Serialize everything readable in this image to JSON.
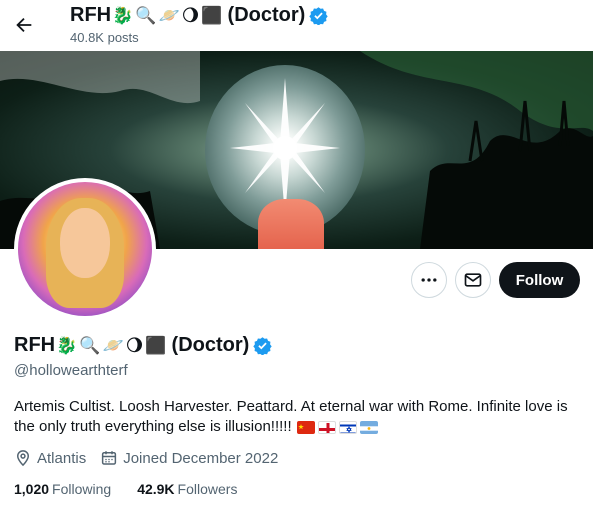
{
  "header": {
    "name_prefix": "RFH",
    "name_suffix": "(Doctor)",
    "emojis": [
      "🐉",
      "🔍",
      "🪐",
      "🌖",
      "⬛"
    ],
    "posts_count": "40.8K posts"
  },
  "profile": {
    "display_name_prefix": "RFH",
    "display_name_suffix": "(Doctor)",
    "handle": "@hollowearthterf",
    "bio": "Artemis Cultist. Loosh Harvester. Peattard. At eternal war with Rome. Infinite love is the only truth everything else is illusion!!!!!",
    "location": "Atlantis",
    "joined": "Joined December 2022",
    "following_count": "1,020",
    "following_label": "Following",
    "followers_count": "42.9K",
    "followers_label": "Followers"
  },
  "actions": {
    "follow_label": "Follow"
  },
  "colors": {
    "verified": "#1d9bf0",
    "text_primary": "#0f1419",
    "text_secondary": "#536471",
    "follow_bg": "#0f1419"
  },
  "icons": {
    "back": "arrow-left-icon",
    "more": "more-dots-icon",
    "message": "envelope-icon",
    "location": "location-pin-icon",
    "calendar": "calendar-icon",
    "verified": "verified-badge-icon"
  }
}
